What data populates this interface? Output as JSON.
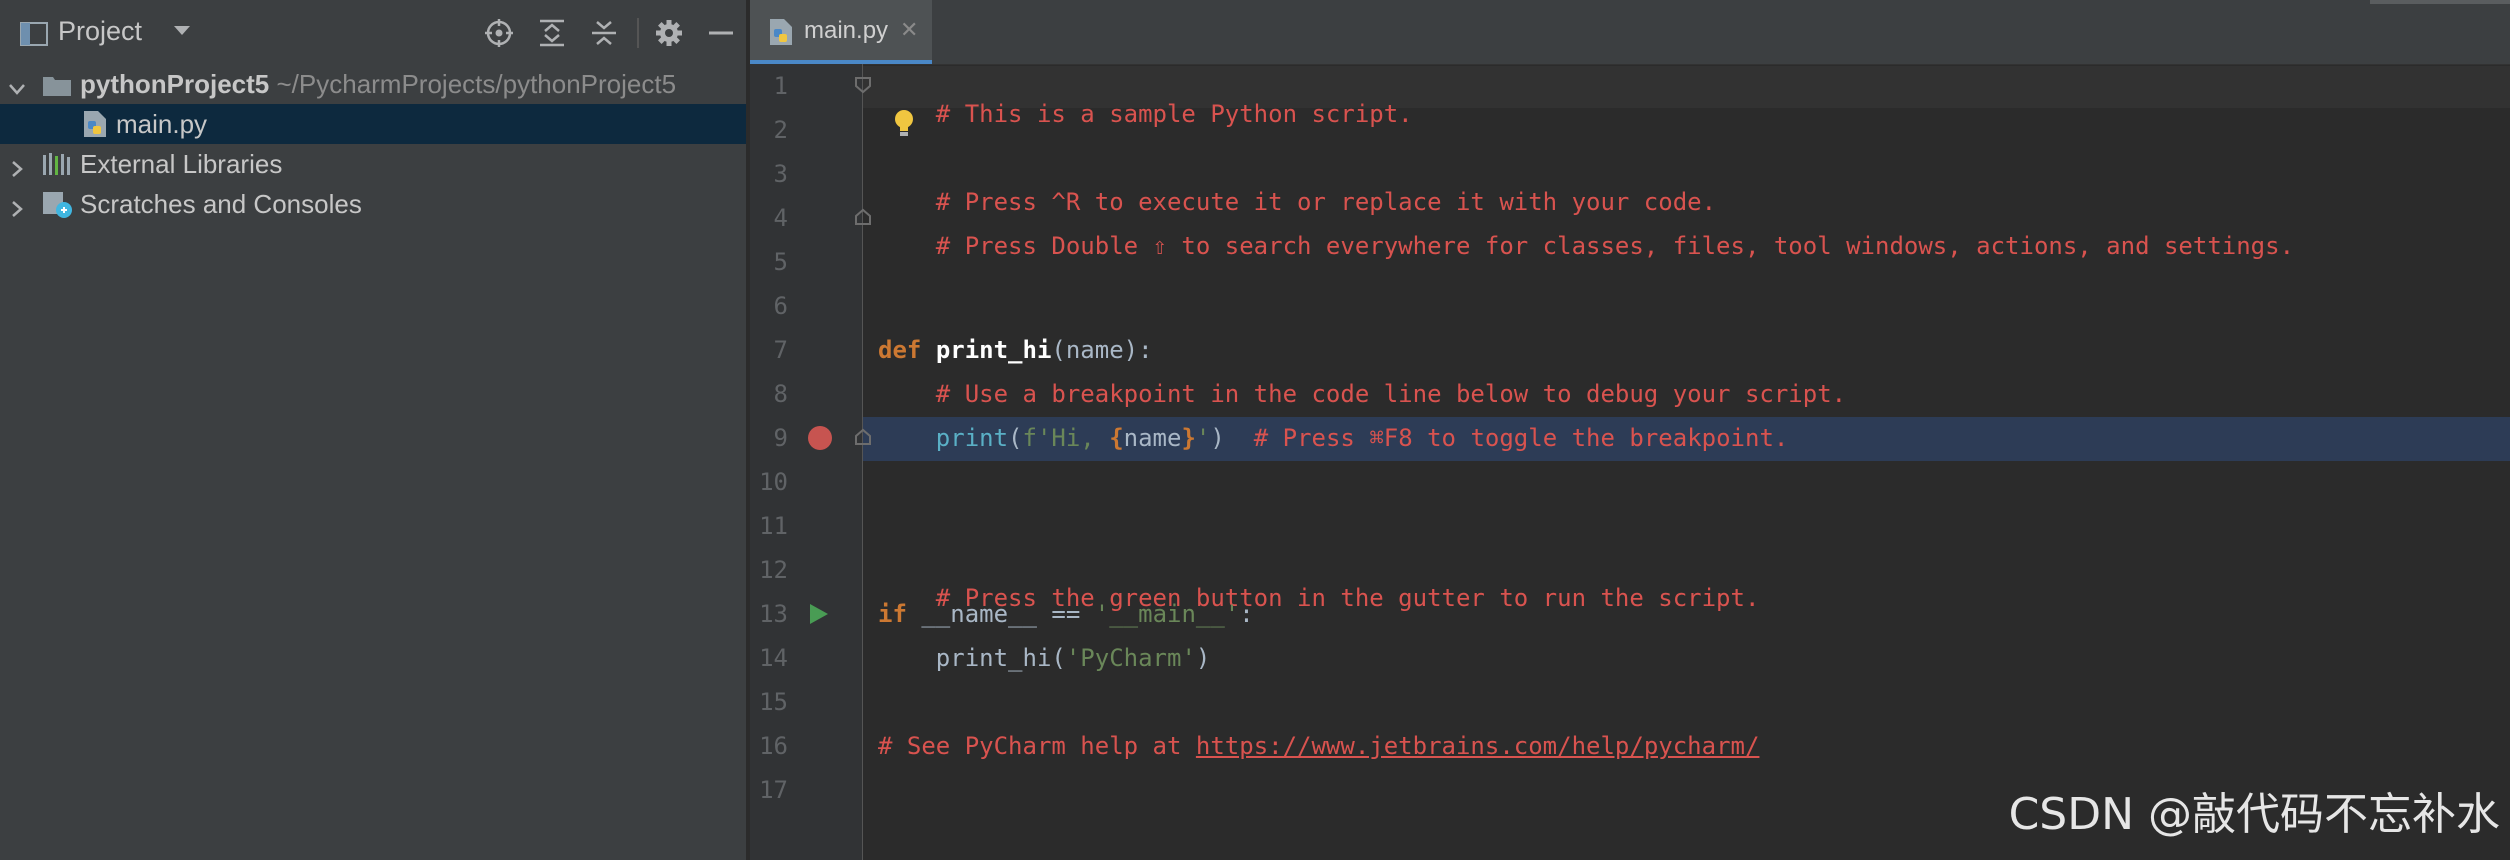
{
  "project_panel": {
    "title": "Project",
    "tree": [
      {
        "label": "pythonProject5",
        "path": "~/PycharmProjects/pythonProject5"
      },
      {
        "label": "main.py"
      },
      {
        "label": "External Libraries"
      },
      {
        "label": "Scratches and Consoles"
      }
    ]
  },
  "editor": {
    "tab": {
      "label": "main.py",
      "close": "✕"
    },
    "line_numbers": [
      "1",
      "2",
      "3",
      "4",
      "5",
      "6",
      "7",
      "8",
      "9",
      "10",
      "11",
      "12",
      "13",
      "14",
      "15",
      "16",
      "17"
    ],
    "code": {
      "l1": "# This is a sample Python script.",
      "l3": "# Press ^R to execute it or replace it with your code.",
      "l4": "# Press Double ⇧ to search everywhere for classes, files, tool windows, actions, and settings.",
      "l7_kw": "def",
      "l7_fn": "print_hi",
      "l7_open": "(",
      "l7_param": "name",
      "l7_close": "):",
      "l8": "# Use a breakpoint in the code line below to debug your script.",
      "l9_call": "print",
      "l9_open": "(",
      "l9_str1": "f'Hi, ",
      "l9_brace1": "{",
      "l9_var": "name",
      "l9_brace2": "}",
      "l9_str2": "'",
      "l9_close": ")",
      "l9_comment": "# Press ⌘F8 to toggle the breakpoint.",
      "l12": "# Press the green button in the gutter to run the script.",
      "l13_kw": "if",
      "l13_var": "__name__",
      "l13_op": "==",
      "l13_str": "'__main__'",
      "l13_colon": ":",
      "l14_call": "print_hi",
      "l14_open": "(",
      "l14_str": "'PyCharm'",
      "l14_close": ")",
      "l16_comment": "# See PyCharm help at ",
      "l16_link": "https://www.jetbrains.com/help/pycharm/"
    }
  },
  "watermark": "CSDN @敲代码不忘补水",
  "colors": {
    "comment": "#d9534f",
    "keyword": "#cc7832",
    "string": "#6a8759",
    "breakpoint": "#c75450",
    "run": "#499c54",
    "selection": "#0d293e"
  }
}
